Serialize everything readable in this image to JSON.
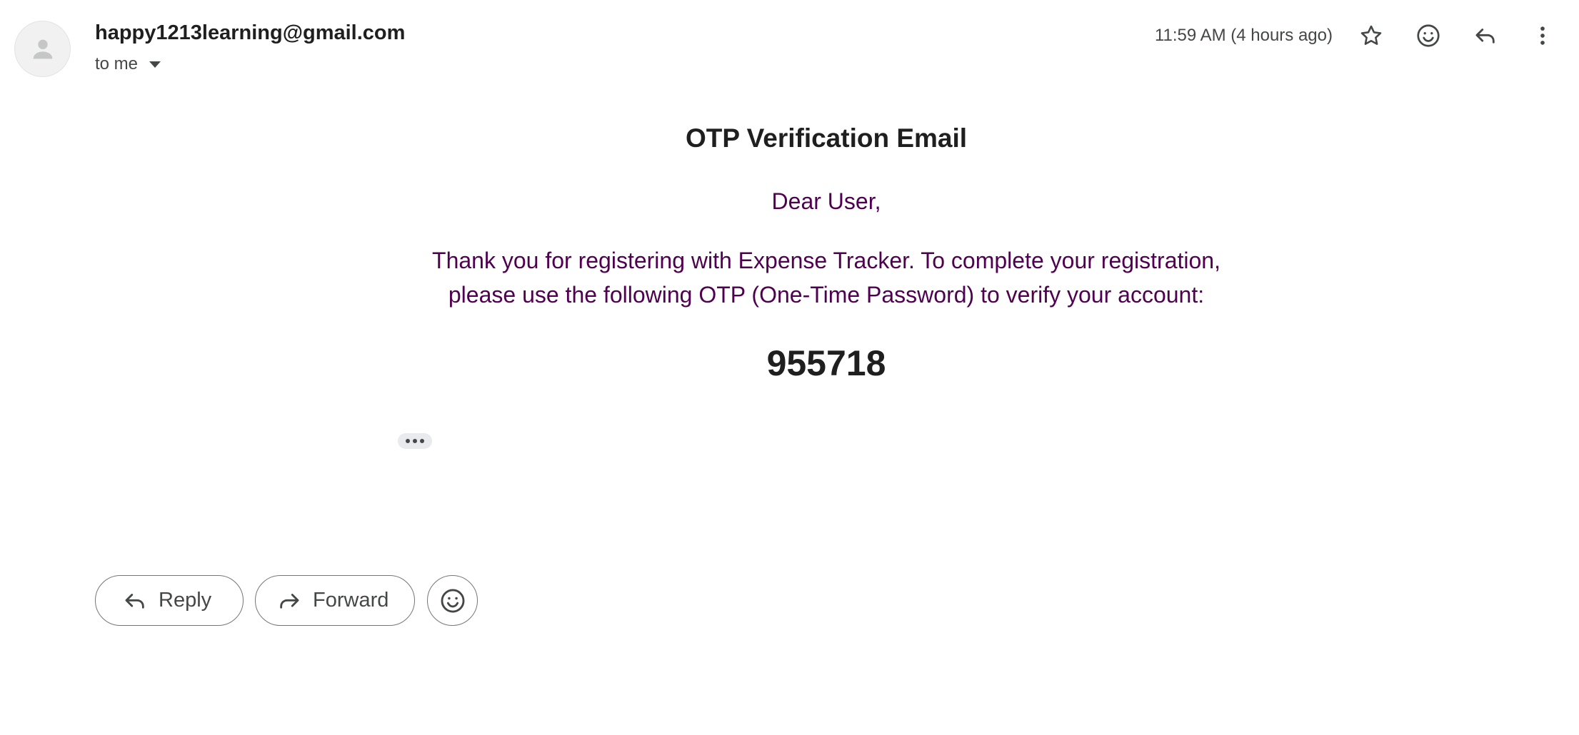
{
  "header": {
    "sender": "happy1213learning@gmail.com",
    "recipients": "to me",
    "timestamp": "11:59 AM (4 hours ago)",
    "icons": [
      "star-icon",
      "emoji-icon",
      "reply-icon",
      "more-vert-icon"
    ]
  },
  "email": {
    "subject": "OTP Verification Email",
    "greeting": "Dear User,",
    "message_line1": "Thank you for registering with Expense Tracker. To complete your registration,",
    "message_line2": "please use the following OTP (One-Time Password) to verify your account:",
    "otp": "955718"
  },
  "actions": {
    "reply_label": "Reply",
    "forward_label": "Forward"
  },
  "colors": {
    "body_text": "#500050",
    "heading_text": "#1f1f1f",
    "muted_text": "#444746",
    "button_border": "#747775"
  }
}
